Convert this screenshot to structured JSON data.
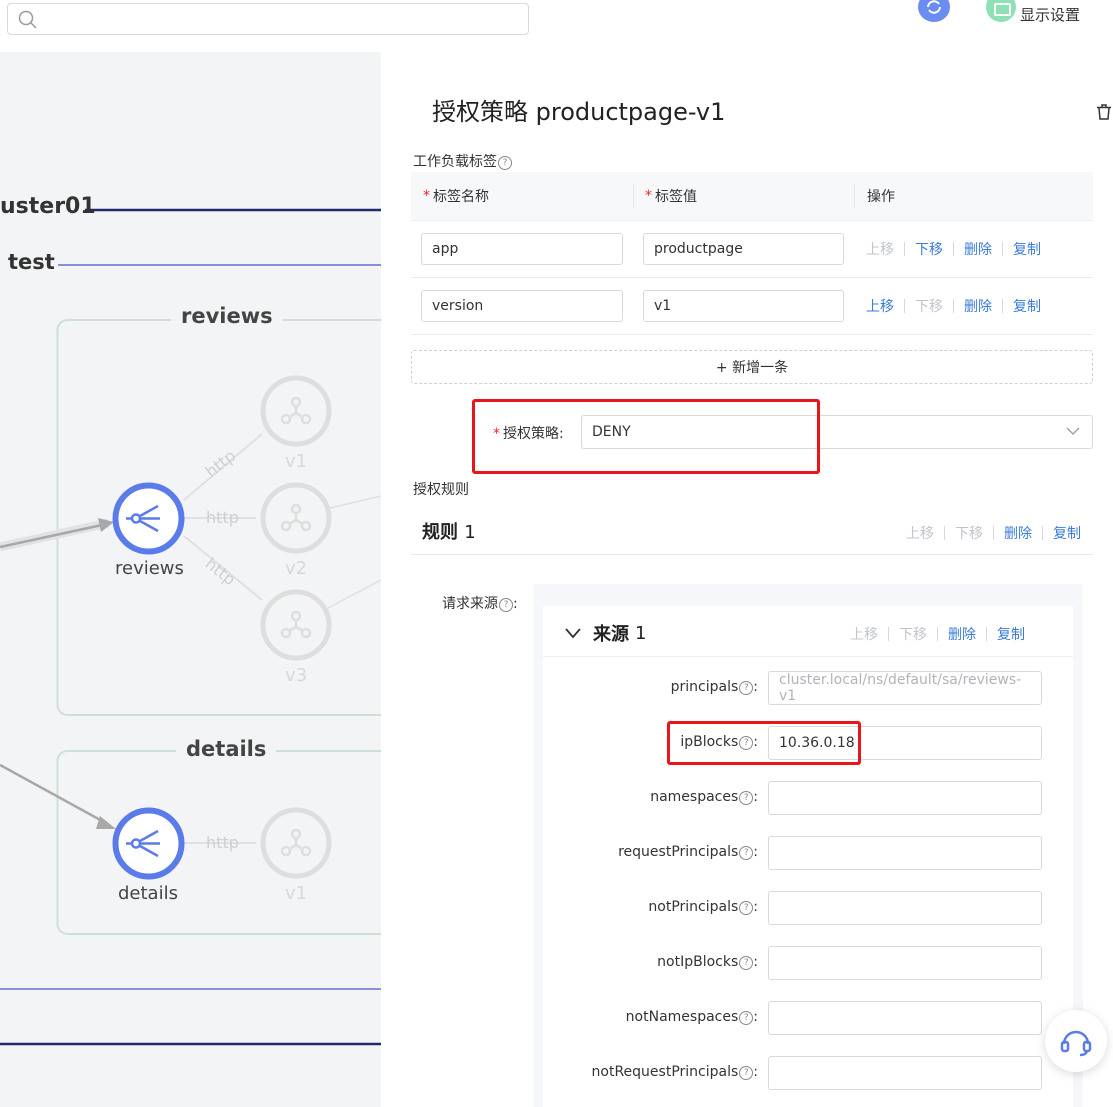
{
  "search": {
    "placeholder": ""
  },
  "toolbar": {
    "display_settings": "显示设置"
  },
  "topology": {
    "cluster": "uster01",
    "namespace": "test",
    "apps": [
      {
        "name": "reviews",
        "service": "reviews",
        "versions": [
          "v1",
          "v2",
          "v3"
        ],
        "edges": [
          "http",
          "http",
          "http"
        ]
      },
      {
        "name": "details",
        "service": "details",
        "versions": [
          "v1"
        ],
        "edges": [
          "http"
        ]
      }
    ]
  },
  "panel": {
    "title": "授权策略 productpage-v1",
    "workload_labels": {
      "section": "工作负载标签",
      "columns": {
        "name": "标签名称",
        "value": "标签值",
        "actions": "操作"
      },
      "rows": [
        {
          "name": "app",
          "value": "productpage",
          "up_disabled": true,
          "down_disabled": false
        },
        {
          "name": "version",
          "value": "v1",
          "up_disabled": false,
          "down_disabled": true
        }
      ],
      "add": "+ 新增一条"
    },
    "ops": {
      "up": "上移",
      "down": "下移",
      "delete": "删除",
      "copy": "复制"
    },
    "policy": {
      "label": "授权策略",
      "value": "DENY"
    },
    "rules": {
      "section": "授权规则",
      "rule_title": "规则",
      "rule_index": "1",
      "source_label": "请求来源",
      "source_title": "来源",
      "source_index": "1",
      "fields": [
        {
          "label": "principals",
          "value": "cluster.local/ns/default/sa/reviews-v1",
          "placeholder": true
        },
        {
          "label": "ipBlocks",
          "value": "10.36.0.18",
          "placeholder": false
        },
        {
          "label": "namespaces",
          "value": "",
          "placeholder": false
        },
        {
          "label": "requestPrincipals",
          "value": "",
          "placeholder": false
        },
        {
          "label": "notPrincipals",
          "value": "",
          "placeholder": false
        },
        {
          "label": "notIpBlocks",
          "value": "",
          "placeholder": false
        },
        {
          "label": "notNamespaces",
          "value": "",
          "placeholder": false
        },
        {
          "label": "notRequestPrincipals",
          "value": "",
          "placeholder": false
        }
      ]
    }
  },
  "colors": {
    "accent": "#3b7bd9",
    "node": "#5b7be8",
    "highlight": "#e8151a",
    "cluster_line": "#1f2a6b",
    "ns_line": "#8a8fd9"
  }
}
